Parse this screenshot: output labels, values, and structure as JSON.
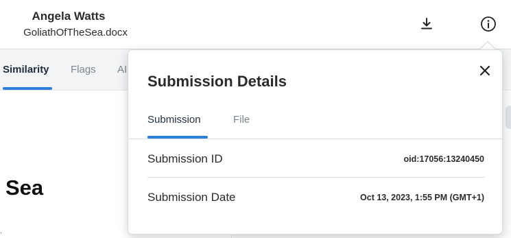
{
  "header": {
    "author": "Angela Watts",
    "filename": "GoliathOfTheSea.docx",
    "icons": [
      "download-icon",
      "info-icon"
    ]
  },
  "tabs": {
    "items": [
      {
        "label": "Similarity",
        "active": true
      },
      {
        "label": "Flags",
        "active": false
      },
      {
        "label": "AI",
        "active": false
      }
    ]
  },
  "document": {
    "heading": "Sea",
    "mark": "."
  },
  "popover": {
    "title": "Submission Details",
    "close_icon": "close-icon",
    "tabs": [
      {
        "label": "Submission",
        "active": true
      },
      {
        "label": "File",
        "active": false
      }
    ],
    "rows": [
      {
        "label": "Submission ID",
        "value": "oid:17056:13240450"
      },
      {
        "label": "Submission Date",
        "value": "Oct 13, 2023, 1:55 PM (GMT+1)"
      }
    ]
  },
  "colors": {
    "accent": "#2b7fd8",
    "tabstrip_bg": "#f3f4f6",
    "text": "#2b2b2b"
  }
}
